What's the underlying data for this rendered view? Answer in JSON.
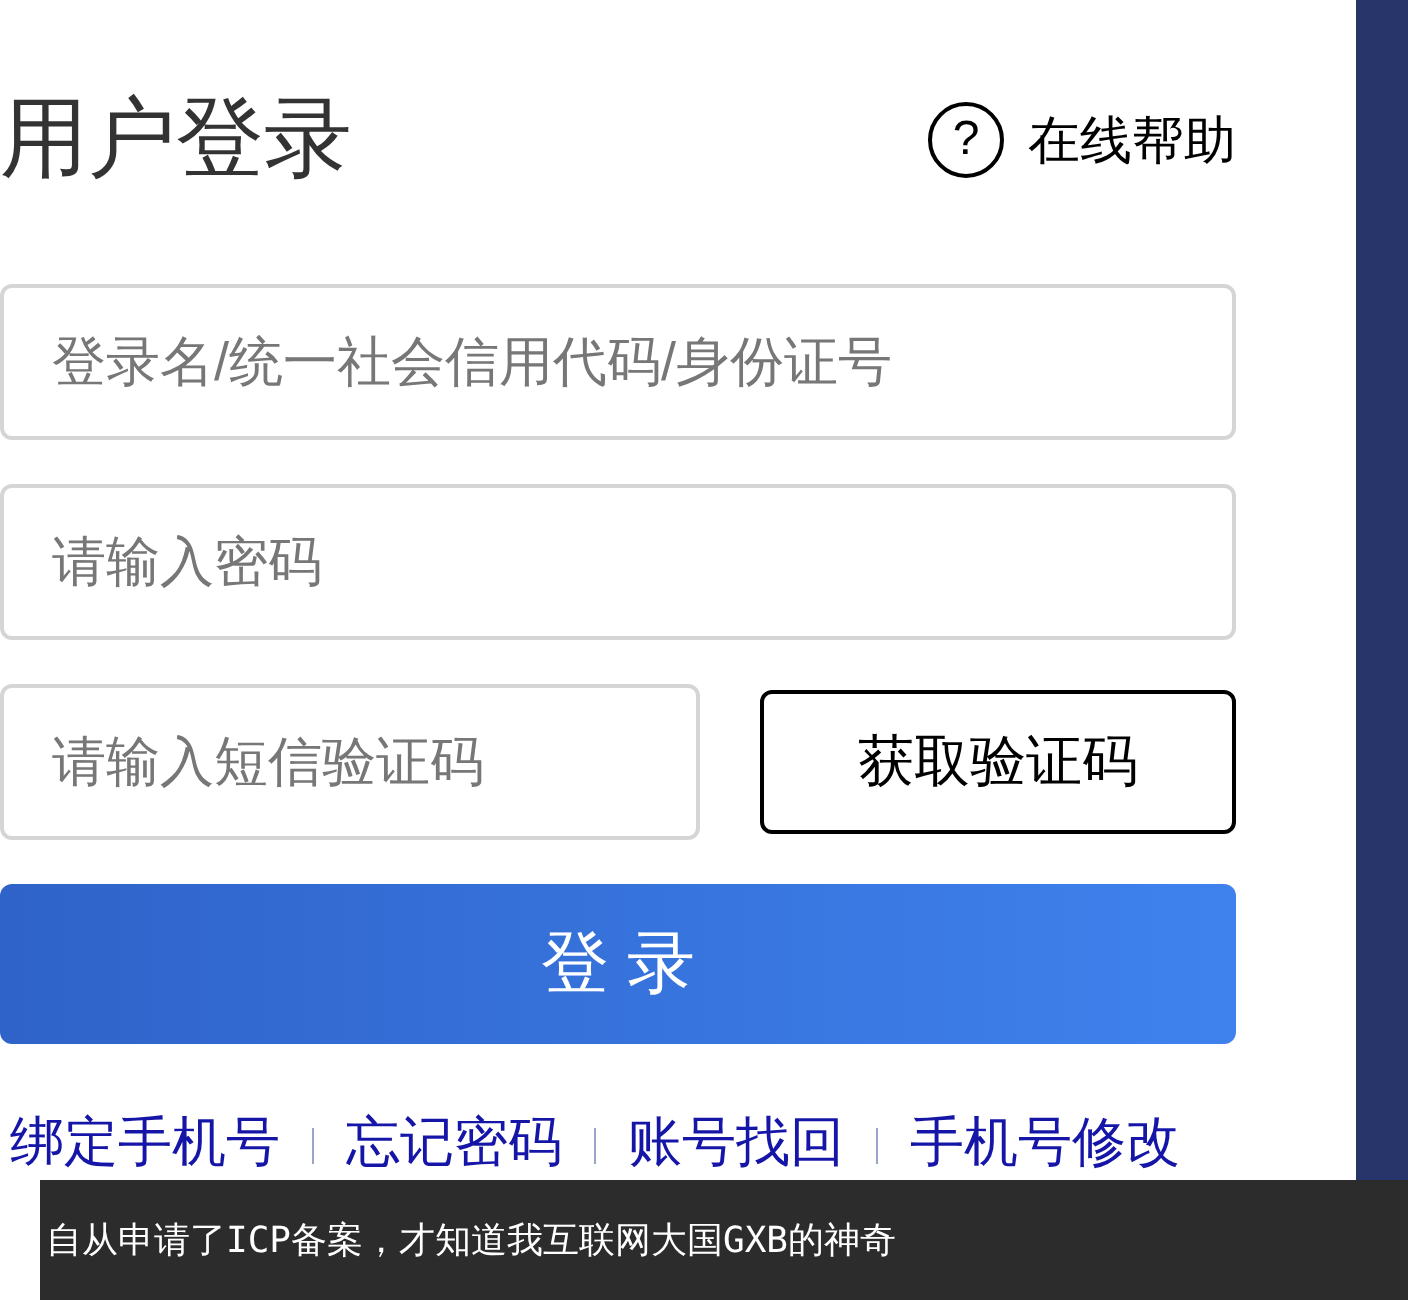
{
  "title": "用户登录",
  "help": {
    "icon": "?",
    "label": "在线帮助"
  },
  "fields": [
    {
      "kind": "text",
      "placeholder": "登录名/统一社会信用代码/身份证号"
    },
    {
      "kind": "password",
      "placeholder": "请输入密码"
    },
    {
      "kind": "sms",
      "placeholder": "请输入短信验证码",
      "button": "获取验证码"
    }
  ],
  "login_button": "登 录",
  "links": [
    "绑定手机号",
    "忘记密码",
    "账号找回",
    "手机号修改"
  ],
  "caption": "自从申请了ICP备案，才知道我互联网大国GXB的神奇"
}
